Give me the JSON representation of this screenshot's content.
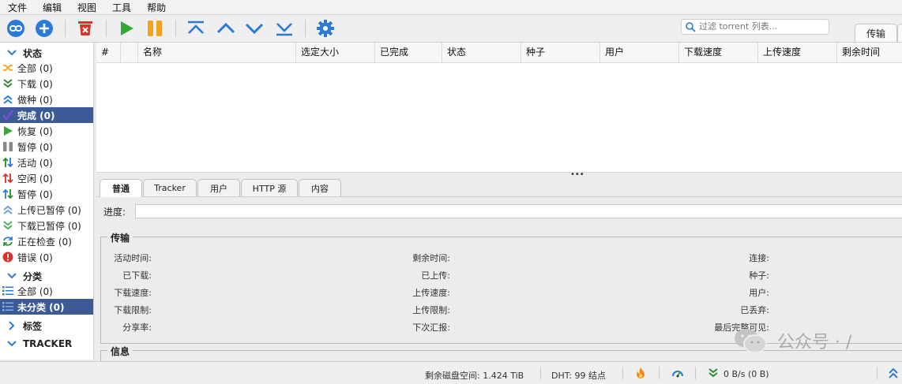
{
  "menu": [
    "文件",
    "编辑",
    "视图",
    "工具",
    "帮助"
  ],
  "toolbar": {
    "filter_placeholder": "过滤 torrent 列表...",
    "tabs": [
      "传输",
      ""
    ]
  },
  "sidebar": {
    "status_header": "状态",
    "status_items": [
      {
        "label": "全部 (0)",
        "icon": "shuffle-icon"
      },
      {
        "label": "下载 (0)",
        "icon": "download-arrows-icon"
      },
      {
        "label": "做种 (0)",
        "icon": "upload-arrows-icon"
      },
      {
        "label": "完成 (0)",
        "icon": "checkmark-icon",
        "selected": true
      },
      {
        "label": "恢复 (0)",
        "icon": "play-icon"
      },
      {
        "label": "暂停 (0)",
        "icon": "pause-icon"
      },
      {
        "label": "活动 (0)",
        "icon": "active-arrows-icon"
      },
      {
        "label": "空闲 (0)",
        "icon": "idle-arrows-icon"
      },
      {
        "label": "暂停 (0)",
        "icon": "stalled-arrows-icon"
      },
      {
        "label": "上传已暂停 (0)",
        "icon": "upload-paused-icon"
      },
      {
        "label": "下载已暂停 (0)",
        "icon": "download-paused-icon"
      },
      {
        "label": "正在检查 (0)",
        "icon": "refresh-icon"
      },
      {
        "label": "错误 (0)",
        "icon": "error-icon"
      }
    ],
    "category_header": "分类",
    "category_items": [
      {
        "label": "全部 (0)",
        "icon": "list-icon"
      },
      {
        "label": "未分类 (0)",
        "icon": "list-icon",
        "selected": true
      }
    ],
    "tags_header": "标签",
    "tracker_header": "TRACKER"
  },
  "table": {
    "columns": [
      "#",
      "",
      "名称",
      "选定大小",
      "已完成",
      "状态",
      "种子",
      "用户",
      "下载速度",
      "上传速度",
      "剩余时间"
    ]
  },
  "details": {
    "tabs": [
      "普通",
      "Tracker",
      "用户",
      "HTTP 源",
      "内容"
    ],
    "progress_label": "进度:",
    "transfer_title": "传输",
    "col1": [
      "活动时间:",
      "已下载:",
      "下载速度:",
      "下载限制:",
      "分享率:"
    ],
    "col2": [
      "剩余时间:",
      "已上传:",
      "上传速度:",
      "上传限制:",
      "下次汇报:"
    ],
    "col3": [
      "连接:",
      "种子:",
      "用户:",
      "已丢弃:",
      "最后完整可见:"
    ],
    "info_title": "信息"
  },
  "statusbar": {
    "disk": "剩余磁盘空间: 1.424 TiB",
    "dht": "DHT: 99 结点",
    "speed": "0 B/s (0 B)"
  },
  "watermark": "公众号 · /",
  "colors": {
    "accent": "#2b7bd6",
    "selected": "#3c5a96",
    "green": "#35a833",
    "orange": "#f3a21c",
    "red": "#d9322b"
  }
}
